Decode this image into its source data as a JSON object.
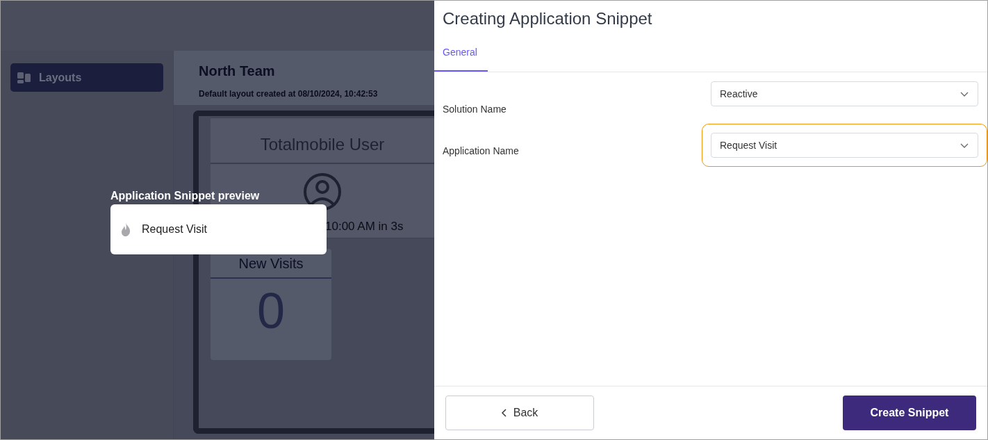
{
  "background": {
    "sidebar": {
      "items": [
        {
          "label": "Layouts",
          "selected": true
        }
      ]
    },
    "header": {
      "title": "North Team",
      "subtitle": "Default layout created at 08/10/2024, 10:42:53"
    },
    "user_card": {
      "title": "Totalmobile User",
      "status": "10:00 AM in 3s"
    },
    "visits_card": {
      "title": "New Visits",
      "count": "0"
    }
  },
  "preview": {
    "label": "Application Snippet preview",
    "item": "Request Visit"
  },
  "panel": {
    "title": "Creating Application Snippet",
    "tabs": [
      {
        "label": "General",
        "selected": true
      }
    ],
    "fields": [
      {
        "label": "Solution Name",
        "value": "Reactive",
        "highlighted": false
      },
      {
        "label": "Application Name",
        "value": "Request Visit",
        "highlighted": true
      }
    ],
    "buttons": {
      "back": "Back",
      "create": "Create Snippet"
    }
  }
}
